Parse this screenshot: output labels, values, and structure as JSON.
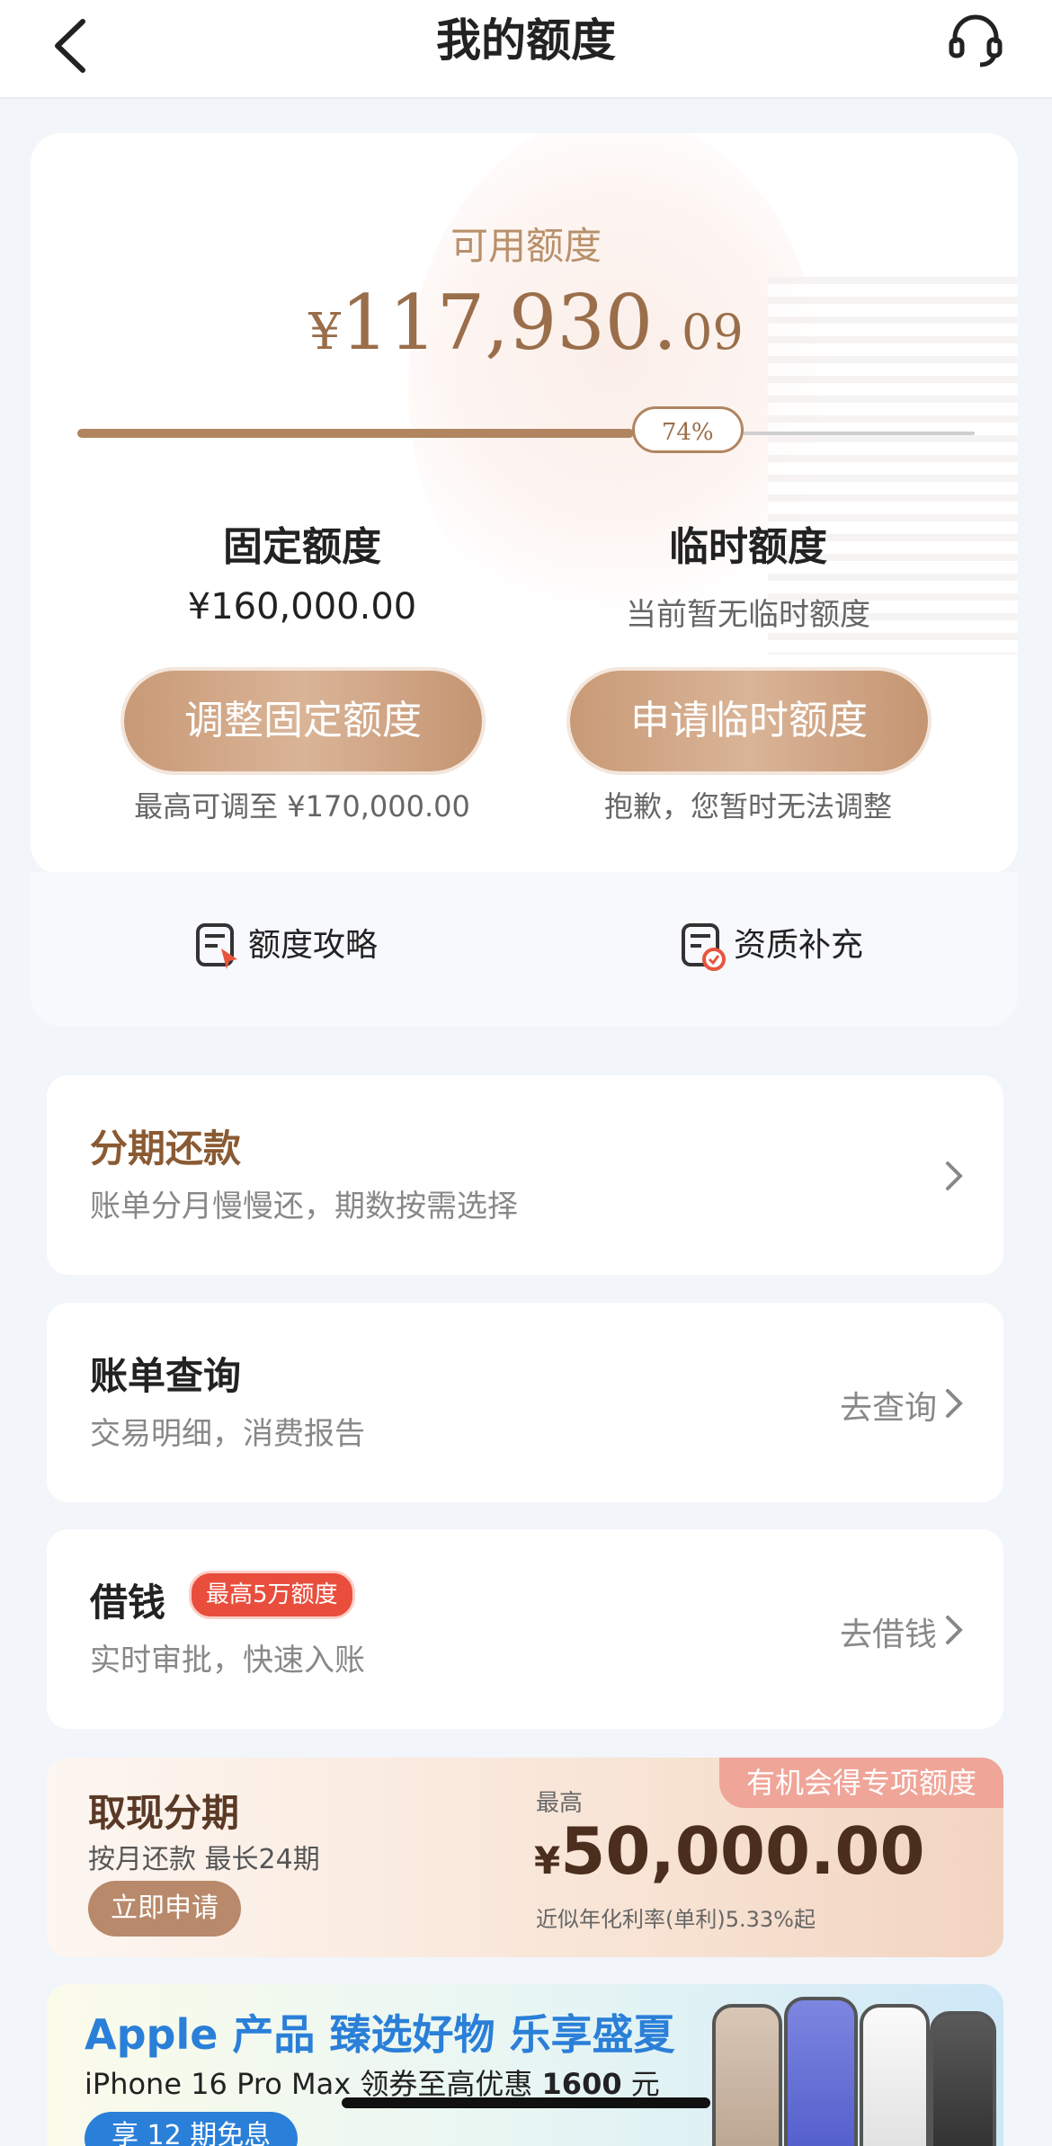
{
  "header": {
    "title": "我的额度",
    "back_icon": "chevron-left-icon",
    "support_icon": "headset-icon"
  },
  "quota": {
    "available_label": "可用额度",
    "currency": "¥",
    "available_integer": "117,930.",
    "available_decimal": "09",
    "usage_percent": 74,
    "usage_percent_label": "74%",
    "fixed": {
      "title": "固定额度",
      "value": "¥160,000.00",
      "button": "调整固定额度",
      "note": "最高可调至 ¥170,000.00"
    },
    "temporary": {
      "title": "临时额度",
      "value": "当前暂无临时额度",
      "button": "申请临时额度",
      "note": "抱歉，您暂时无法调整"
    },
    "links": [
      {
        "label": "额度攻略",
        "icon": "guide-doc-icon"
      },
      {
        "label": "资质补充",
        "icon": "qualification-doc-icon"
      }
    ]
  },
  "items": {
    "installment": {
      "title": "分期还款",
      "subtitle": "账单分月慢慢还，期数按需选择"
    },
    "bill": {
      "title": "账单查询",
      "subtitle": "交易明细，消费报告",
      "action": "去查询"
    },
    "borrow": {
      "title": "借钱",
      "badge": "最高5万额度",
      "subtitle": "实时审批，快速入账",
      "action": "去借钱"
    }
  },
  "cash_installment": {
    "title": "取现分期",
    "subtitle": "按月还款 最长24期",
    "button": "立即申请",
    "tag": "有机会得专项额度",
    "max_label": "最高",
    "currency": "¥",
    "amount": "50,000.00",
    "rate_note": "近似年化利率(单利)5.33%起"
  },
  "banner": {
    "headline": "Apple 产品 臻选好物 乐享盛夏",
    "line2_prefix": "iPhone 16 Pro Max 领券至高优惠 ",
    "line2_amount": "1600",
    "line2_suffix": " 元",
    "pill_text": "享 12 期免息 "
  },
  "colors": {
    "accent_gold": "#b08560",
    "button_gradient_start": "#c89a77",
    "badge_red": "#e94e3d",
    "banner_blue": "#2a7fd8"
  }
}
